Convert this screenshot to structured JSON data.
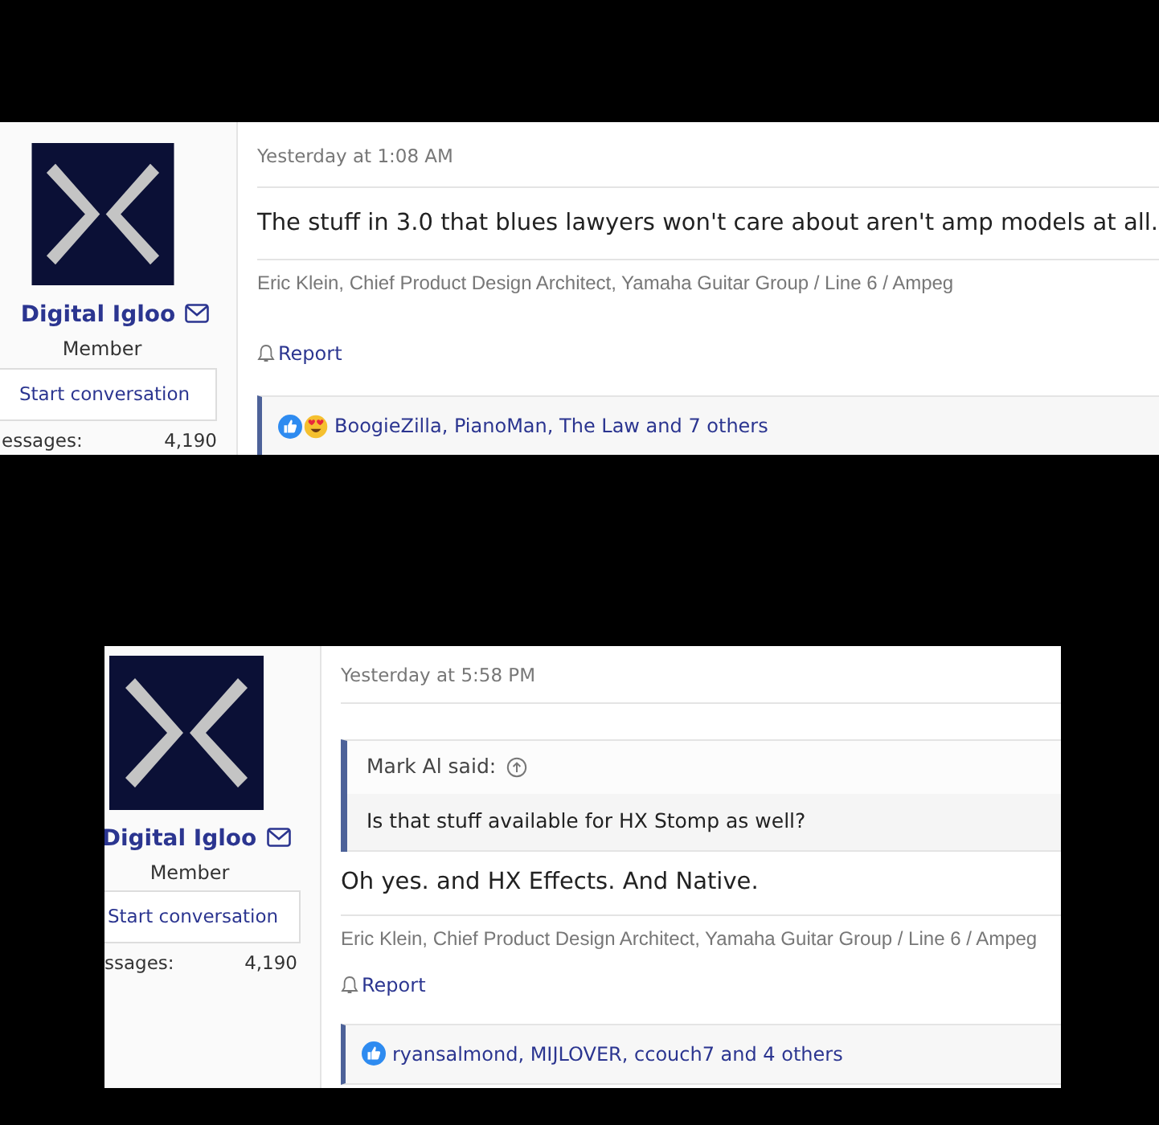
{
  "posts": [
    {
      "user": {
        "name": "Digital Igloo",
        "title": "Member",
        "start_conversation": "Start conversation",
        "stats_label": "essages:",
        "stats_value": "4,190"
      },
      "timestamp": "Yesterday at 1:08 AM",
      "body": "The stuff in 3.0 that blues lawyers won't care about aren't amp models at all.",
      "signature": "Eric Klein, Chief Product Design Architect, Yamaha Guitar Group / Line 6 / Ampeg",
      "report": "Report",
      "reactions": {
        "icons": [
          {
            "kind": "like"
          },
          {
            "kind": "love"
          }
        ],
        "text": "BoogieZilla, PianoMan, The Law and 7 others"
      }
    },
    {
      "user": {
        "name": "Digital Igloo",
        "title": "Member",
        "start_conversation": "Start conversation",
        "stats_label": "ssages:",
        "stats_value": "4,190"
      },
      "timestamp": "Yesterday at 5:58 PM",
      "quote": {
        "author": "Mark Al said:",
        "text": "Is that stuff available for HX Stomp as well?"
      },
      "body": "Oh yes. and HX Effects. And Native.",
      "signature": "Eric Klein, Chief Product Design Architect, Yamaha Guitar Group / Line 6 / Ampeg",
      "report": "Report",
      "reactions": {
        "icons": [
          {
            "kind": "like"
          }
        ],
        "text": "ryansalmond, MIJLOVER, ccouch7 and 4 others"
      }
    }
  ]
}
